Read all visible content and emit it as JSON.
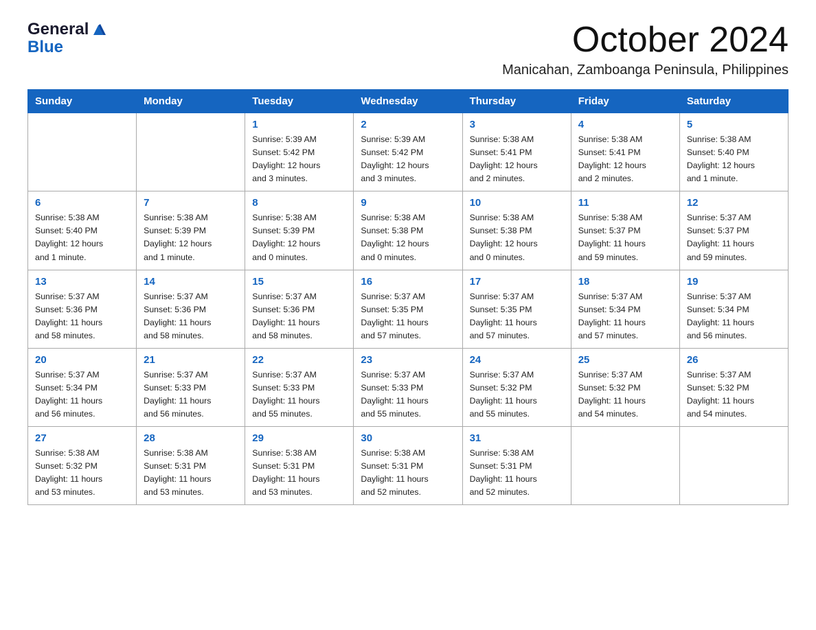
{
  "header": {
    "logo_general": "General",
    "logo_blue": "Blue",
    "month_year": "October 2024",
    "location": "Manicahan, Zamboanga Peninsula, Philippines"
  },
  "calendar": {
    "days_of_week": [
      "Sunday",
      "Monday",
      "Tuesday",
      "Wednesday",
      "Thursday",
      "Friday",
      "Saturday"
    ],
    "weeks": [
      [
        {
          "day": "",
          "info": ""
        },
        {
          "day": "",
          "info": ""
        },
        {
          "day": "1",
          "info": "Sunrise: 5:39 AM\nSunset: 5:42 PM\nDaylight: 12 hours\nand 3 minutes."
        },
        {
          "day": "2",
          "info": "Sunrise: 5:39 AM\nSunset: 5:42 PM\nDaylight: 12 hours\nand 3 minutes."
        },
        {
          "day": "3",
          "info": "Sunrise: 5:38 AM\nSunset: 5:41 PM\nDaylight: 12 hours\nand 2 minutes."
        },
        {
          "day": "4",
          "info": "Sunrise: 5:38 AM\nSunset: 5:41 PM\nDaylight: 12 hours\nand 2 minutes."
        },
        {
          "day": "5",
          "info": "Sunrise: 5:38 AM\nSunset: 5:40 PM\nDaylight: 12 hours\nand 1 minute."
        }
      ],
      [
        {
          "day": "6",
          "info": "Sunrise: 5:38 AM\nSunset: 5:40 PM\nDaylight: 12 hours\nand 1 minute."
        },
        {
          "day": "7",
          "info": "Sunrise: 5:38 AM\nSunset: 5:39 PM\nDaylight: 12 hours\nand 1 minute."
        },
        {
          "day": "8",
          "info": "Sunrise: 5:38 AM\nSunset: 5:39 PM\nDaylight: 12 hours\nand 0 minutes."
        },
        {
          "day": "9",
          "info": "Sunrise: 5:38 AM\nSunset: 5:38 PM\nDaylight: 12 hours\nand 0 minutes."
        },
        {
          "day": "10",
          "info": "Sunrise: 5:38 AM\nSunset: 5:38 PM\nDaylight: 12 hours\nand 0 minutes."
        },
        {
          "day": "11",
          "info": "Sunrise: 5:38 AM\nSunset: 5:37 PM\nDaylight: 11 hours\nand 59 minutes."
        },
        {
          "day": "12",
          "info": "Sunrise: 5:37 AM\nSunset: 5:37 PM\nDaylight: 11 hours\nand 59 minutes."
        }
      ],
      [
        {
          "day": "13",
          "info": "Sunrise: 5:37 AM\nSunset: 5:36 PM\nDaylight: 11 hours\nand 58 minutes."
        },
        {
          "day": "14",
          "info": "Sunrise: 5:37 AM\nSunset: 5:36 PM\nDaylight: 11 hours\nand 58 minutes."
        },
        {
          "day": "15",
          "info": "Sunrise: 5:37 AM\nSunset: 5:36 PM\nDaylight: 11 hours\nand 58 minutes."
        },
        {
          "day": "16",
          "info": "Sunrise: 5:37 AM\nSunset: 5:35 PM\nDaylight: 11 hours\nand 57 minutes."
        },
        {
          "day": "17",
          "info": "Sunrise: 5:37 AM\nSunset: 5:35 PM\nDaylight: 11 hours\nand 57 minutes."
        },
        {
          "day": "18",
          "info": "Sunrise: 5:37 AM\nSunset: 5:34 PM\nDaylight: 11 hours\nand 57 minutes."
        },
        {
          "day": "19",
          "info": "Sunrise: 5:37 AM\nSunset: 5:34 PM\nDaylight: 11 hours\nand 56 minutes."
        }
      ],
      [
        {
          "day": "20",
          "info": "Sunrise: 5:37 AM\nSunset: 5:34 PM\nDaylight: 11 hours\nand 56 minutes."
        },
        {
          "day": "21",
          "info": "Sunrise: 5:37 AM\nSunset: 5:33 PM\nDaylight: 11 hours\nand 56 minutes."
        },
        {
          "day": "22",
          "info": "Sunrise: 5:37 AM\nSunset: 5:33 PM\nDaylight: 11 hours\nand 55 minutes."
        },
        {
          "day": "23",
          "info": "Sunrise: 5:37 AM\nSunset: 5:33 PM\nDaylight: 11 hours\nand 55 minutes."
        },
        {
          "day": "24",
          "info": "Sunrise: 5:37 AM\nSunset: 5:32 PM\nDaylight: 11 hours\nand 55 minutes."
        },
        {
          "day": "25",
          "info": "Sunrise: 5:37 AM\nSunset: 5:32 PM\nDaylight: 11 hours\nand 54 minutes."
        },
        {
          "day": "26",
          "info": "Sunrise: 5:37 AM\nSunset: 5:32 PM\nDaylight: 11 hours\nand 54 minutes."
        }
      ],
      [
        {
          "day": "27",
          "info": "Sunrise: 5:38 AM\nSunset: 5:32 PM\nDaylight: 11 hours\nand 53 minutes."
        },
        {
          "day": "28",
          "info": "Sunrise: 5:38 AM\nSunset: 5:31 PM\nDaylight: 11 hours\nand 53 minutes."
        },
        {
          "day": "29",
          "info": "Sunrise: 5:38 AM\nSunset: 5:31 PM\nDaylight: 11 hours\nand 53 minutes."
        },
        {
          "day": "30",
          "info": "Sunrise: 5:38 AM\nSunset: 5:31 PM\nDaylight: 11 hours\nand 52 minutes."
        },
        {
          "day": "31",
          "info": "Sunrise: 5:38 AM\nSunset: 5:31 PM\nDaylight: 11 hours\nand 52 minutes."
        },
        {
          "day": "",
          "info": ""
        },
        {
          "day": "",
          "info": ""
        }
      ]
    ]
  }
}
